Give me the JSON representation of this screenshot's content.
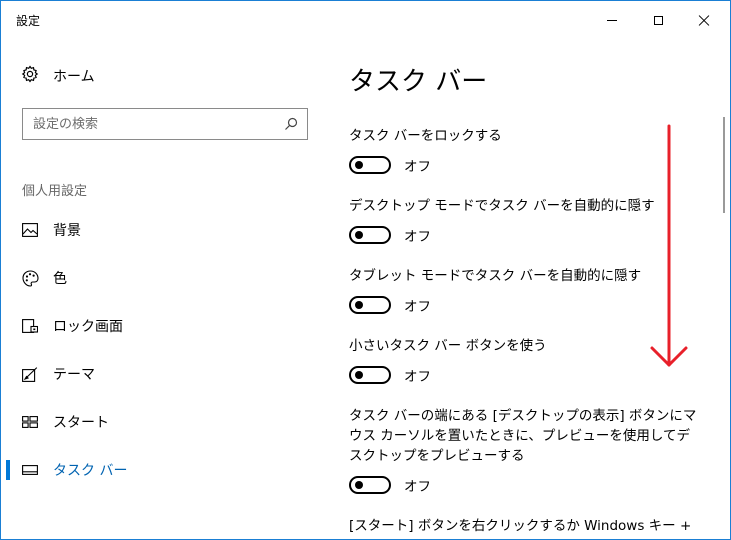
{
  "window": {
    "title": "設定"
  },
  "colors": {
    "accent": "#0078d7",
    "annotation": "#e8202a"
  },
  "sidebar": {
    "home_label": "ホーム",
    "search_placeholder": "設定の検索",
    "section_header": "個人用設定",
    "items": [
      {
        "label": "背景",
        "icon": "picture-icon"
      },
      {
        "label": "色",
        "icon": "palette-icon"
      },
      {
        "label": "ロック画面",
        "icon": "lock-screen-icon"
      },
      {
        "label": "テーマ",
        "icon": "theme-icon"
      },
      {
        "label": "スタート",
        "icon": "start-icon"
      },
      {
        "label": "タスク バー",
        "icon": "taskbar-icon",
        "selected": true
      }
    ]
  },
  "main": {
    "title": "タスク バー",
    "settings": [
      {
        "label": "タスク バーをロックする",
        "state": "オフ"
      },
      {
        "label": "デスクトップ モードでタスク バーを自動的に隠す",
        "state": "オフ"
      },
      {
        "label": "タブレット モードでタスク バーを自動的に隠す",
        "state": "オフ"
      },
      {
        "label": "小さいタスク バー ボタンを使う",
        "state": "オフ"
      },
      {
        "label": "タスク バーの端にある [デスクトップの表示] ボタンにマウス カーソルを置いたときに、プレビューを使用してデスクトップをプレビューする",
        "state": "オフ"
      },
      {
        "label": "[スタート] ボタンを右クリックするか Windows キー + X キー"
      }
    ]
  }
}
